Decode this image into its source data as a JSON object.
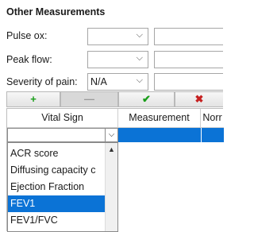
{
  "section_title": "Other Measurements",
  "fields": [
    {
      "label": "Pulse ox:",
      "value": ""
    },
    {
      "label": "Peak flow:",
      "value": ""
    },
    {
      "label": "Severity of pain:",
      "value": "N/A"
    }
  ],
  "toolbar": {
    "add": "+",
    "remove": "—",
    "confirm": "✔",
    "cancel": "✖"
  },
  "colors": {
    "add": "#1a9e1a",
    "confirm": "#1a9e1a",
    "cancel": "#c62020",
    "selection": "#0b73d6"
  },
  "grid": {
    "headers": [
      "Vital Sign",
      "Measurement",
      "Norr"
    ],
    "dropdown_items": [
      "ACR score",
      "Diffusing capacity c",
      "Ejection Fraction",
      "FEV1",
      "FEV1/FVC"
    ],
    "selected_item": "FEV1"
  }
}
